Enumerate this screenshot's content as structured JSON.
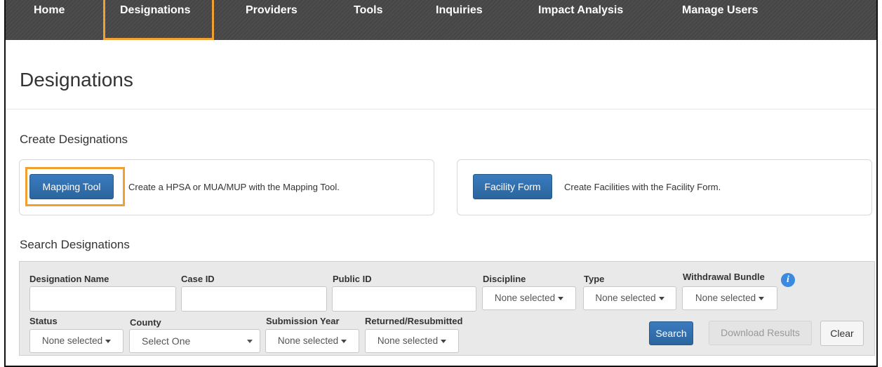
{
  "nav": {
    "items": [
      "Home",
      "Designations",
      "Providers",
      "Tools",
      "Inquiries",
      "Impact Analysis",
      "Manage Users"
    ],
    "active": "Designations",
    "highlight_color": "#f0a030",
    "bar_color": "#474747"
  },
  "page": {
    "title": "Designations"
  },
  "create": {
    "title": "Create Designations",
    "mapping_button": "Mapping Tool",
    "mapping_text": "Create a HPSA or MUA/MUP with the Mapping Tool.",
    "facility_button": "Facility Form",
    "facility_text": "Create Facilities with the Facility Form."
  },
  "search": {
    "title": "Search Designations",
    "labels": {
      "designation_name": "Designation Name",
      "case_id": "Case ID",
      "public_id": "Public ID",
      "discipline": "Discipline",
      "type": "Type",
      "withdrawal_bundle": "Withdrawal Bundle",
      "status": "Status",
      "county": "County",
      "submission_year": "Submission Year",
      "returned_resubmitted": "Returned/Resubmitted"
    },
    "values": {
      "designation_name": "",
      "case_id": "",
      "public_id": "",
      "discipline": "None selected",
      "type": "None selected",
      "withdrawal_bundle": "None selected",
      "status": "None selected",
      "county": "Select One",
      "submission_year": "None selected",
      "returned_resubmitted": "None selected"
    },
    "buttons": {
      "search": "Search",
      "download": "Download Results",
      "clear": "Clear"
    },
    "info_glyph": "i"
  },
  "colors": {
    "primary": "#2e6da4",
    "panel_bg": "#e9e9e9",
    "info_icon": "#3b8ae0"
  }
}
